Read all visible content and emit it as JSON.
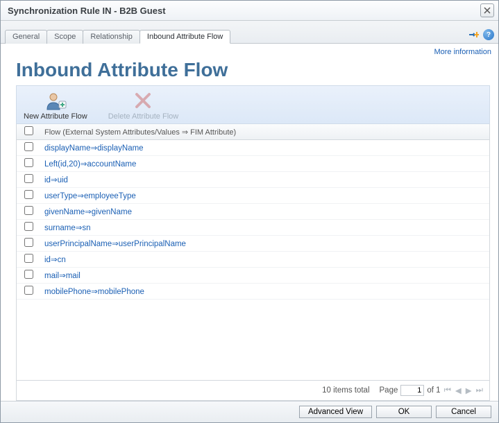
{
  "window": {
    "title": "Synchronization Rule IN - B2B Guest"
  },
  "tabs": [
    {
      "label": "General",
      "active": false
    },
    {
      "label": "Scope",
      "active": false
    },
    {
      "label": "Relationship",
      "active": false
    },
    {
      "label": "Inbound Attribute Flow",
      "active": true
    }
  ],
  "more_info": "More information",
  "page": {
    "title": "Inbound Attribute Flow"
  },
  "toolbar": {
    "new_label": "New Attribute Flow",
    "delete_label": "Delete Attribute Flow"
  },
  "grid": {
    "header": "Flow (External System Attributes/Values ⇒ FIM Attribute)",
    "rows": [
      {
        "flow": "displayName⇒displayName"
      },
      {
        "flow": "Left(id,20)⇒accountName"
      },
      {
        "flow": "id⇒uid"
      },
      {
        "flow": "userType⇒employeeType"
      },
      {
        "flow": "givenName⇒givenName"
      },
      {
        "flow": "surname⇒sn"
      },
      {
        "flow": "userPrincipalName⇒userPrincipalName"
      },
      {
        "flow": "id⇒cn"
      },
      {
        "flow": "mail⇒mail"
      },
      {
        "flow": "mobilePhone⇒mobilePhone"
      }
    ],
    "total_label": "10 items total",
    "pager": {
      "page_label": "Page",
      "page_value": "1",
      "of_label": "of 1"
    }
  },
  "footer": {
    "advanced": "Advanced View",
    "ok": "OK",
    "cancel": "Cancel"
  }
}
